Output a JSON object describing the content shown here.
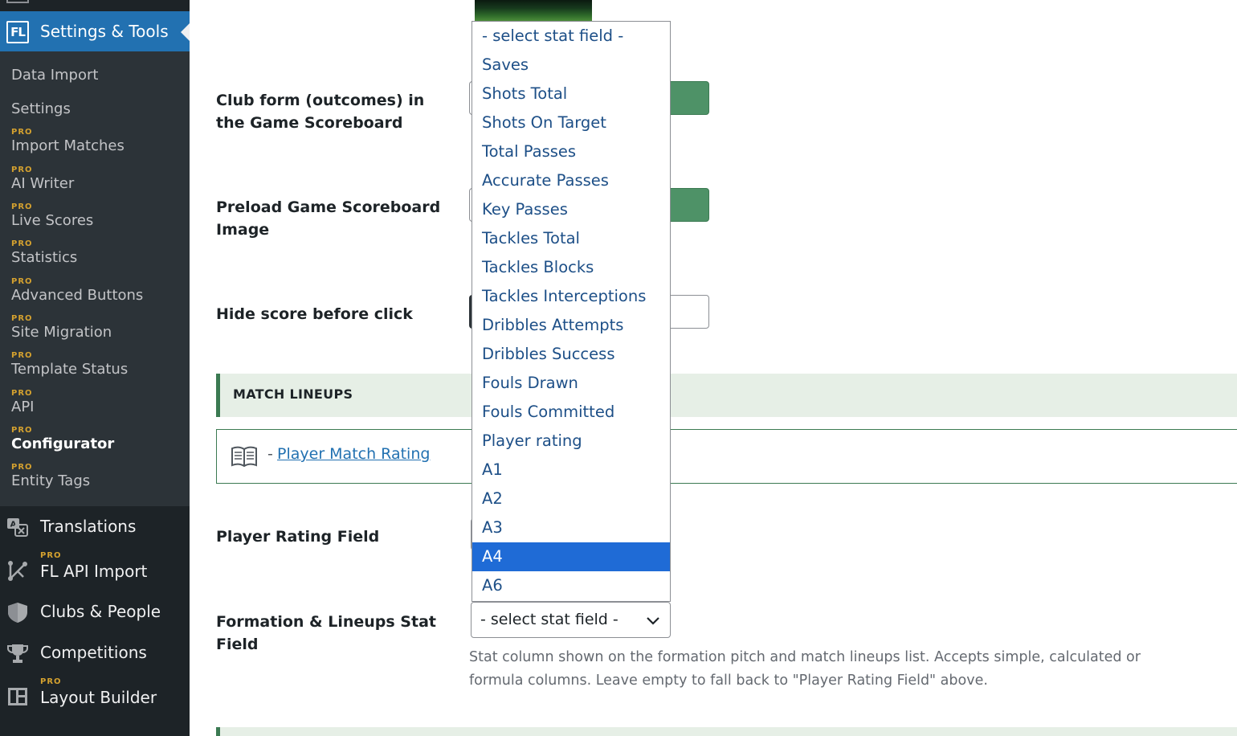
{
  "sidebar": {
    "current_menu": {
      "logo": "FL",
      "label": "Settings & Tools"
    },
    "submenu": [
      {
        "pro": "",
        "label": "Data Import"
      },
      {
        "pro": "",
        "label": "Settings"
      },
      {
        "pro": "PRO",
        "label": "Import Matches"
      },
      {
        "pro": "PRO",
        "label": "AI Writer"
      },
      {
        "pro": "PRO",
        "label": "Live Scores"
      },
      {
        "pro": "PRO",
        "label": "Statistics"
      },
      {
        "pro": "PRO",
        "label": "Advanced Buttons"
      },
      {
        "pro": "PRO",
        "label": "Site Migration"
      },
      {
        "pro": "PRO",
        "label": "Template Status"
      },
      {
        "pro": "PRO",
        "label": "API"
      },
      {
        "pro": "PRO",
        "label": "Configurator"
      },
      {
        "pro": "PRO",
        "label": "Entity Tags"
      }
    ],
    "menu": [
      {
        "icon": "translate-icon",
        "pro": "",
        "label": "Translations"
      },
      {
        "icon": "api-import-icon",
        "pro": "PRO",
        "label": "FL API Import"
      },
      {
        "icon": "shield-icon",
        "pro": "",
        "label": "Clubs & People"
      },
      {
        "icon": "trophy-icon",
        "pro": "",
        "label": "Competitions"
      },
      {
        "icon": "layout-icon",
        "pro": "PRO",
        "label": "Layout Builder"
      }
    ]
  },
  "main": {
    "fields": {
      "club_form": "Club form (outcomes) in the Game Scoreboard",
      "preload_image": "Preload Game Scoreboard Image",
      "hide_score": "Hide score before click",
      "player_rating_field": "Player Rating Field",
      "formation_stat_field": "Formation & Lineups Stat Field"
    },
    "section_title": "MATCH LINEUPS",
    "doc_dash": "-",
    "doc_link": "Player Match Rating",
    "formation_select_value": "- select stat field -",
    "help_text": "Stat column shown on the formation pitch and match lineups list. Accepts simple, calculated or formula columns. Leave empty to fall back to \"Player Rating Field\" above."
  },
  "dropdown": {
    "options": [
      "- select stat field -",
      "Saves",
      "Shots Total",
      "Shots On Target",
      "Total Passes",
      "Accurate Passes",
      "Key Passes",
      "Tackles Total",
      "Tackles Blocks",
      "Tackles Interceptions",
      "Dribbles Attempts",
      "Dribbles Success",
      "Fouls Drawn",
      "Fouls Committed",
      "Player rating",
      "A1",
      "A2",
      "A3",
      "A4",
      "A6"
    ],
    "highlighted": "A4"
  },
  "colors": {
    "sidebar_bg": "#1d2327",
    "submenu_bg": "#2c3338",
    "accent_blue": "#2271b1",
    "pro_gold": "#d4a12f",
    "green": "#3b7a52",
    "highlight": "#1f6bd6"
  }
}
